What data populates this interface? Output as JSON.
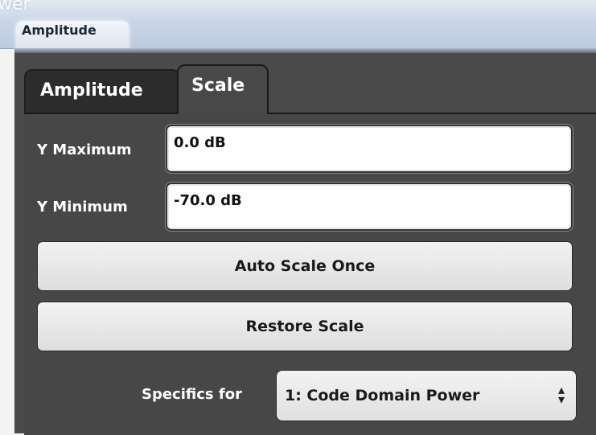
{
  "window": {
    "title_fragment": "wer",
    "title": "Amplitude"
  },
  "tabs": [
    {
      "label": "Amplitude",
      "active": false
    },
    {
      "label": "Scale",
      "active": true
    }
  ],
  "fields": {
    "y_max": {
      "label": "Y Maximum",
      "value": "0.0 dB"
    },
    "y_min": {
      "label": "Y Minimum",
      "value": "-70.0 dB"
    }
  },
  "buttons": {
    "auto_scale": "Auto Scale Once",
    "restore_scale": "Restore Scale"
  },
  "specifics": {
    "label": "Specifics for",
    "selected": "1: Code Domain Power"
  },
  "colors": {
    "titlebar": "#c9d5e6",
    "panel": "#474747",
    "active_tab": "#484848",
    "inactive_tab": "#2c2c2c",
    "button": "#e8e8e8"
  }
}
